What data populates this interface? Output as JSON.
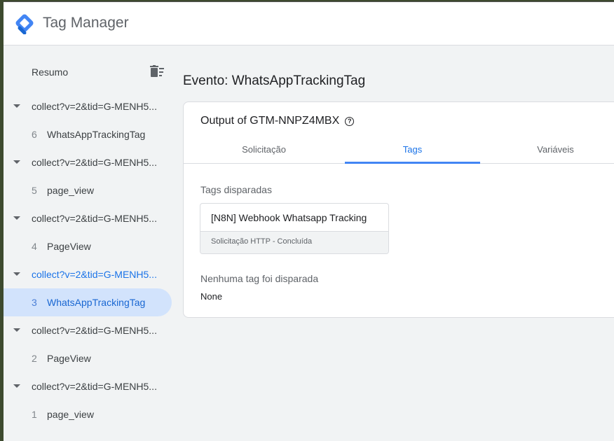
{
  "header": {
    "title": "Tag Manager"
  },
  "sidebar": {
    "summary_label": "Resumo",
    "groups": [
      {
        "label": "collect?v=2&tid=G-MENH5...",
        "child_num": "6",
        "child_name": "WhatsAppTrackingTag"
      },
      {
        "label": "collect?v=2&tid=G-MENH5...",
        "child_num": "5",
        "child_name": "page_view"
      },
      {
        "label": "collect?v=2&tid=G-MENH5...",
        "child_num": "4",
        "child_name": "PageView"
      },
      {
        "label": "collect?v=2&tid=G-MENH5...",
        "child_num": "3",
        "child_name": "WhatsAppTrackingTag",
        "selected": true
      },
      {
        "label": "collect?v=2&tid=G-MENH5...",
        "child_num": "2",
        "child_name": "PageView"
      },
      {
        "label": "collect?v=2&tid=G-MENH5...",
        "child_num": "1",
        "child_name": "page_view"
      }
    ]
  },
  "main": {
    "event_title": "Evento: WhatsAppTrackingTag",
    "card_title": "Output of GTM-NNPZ4MBX",
    "tabs": [
      {
        "label": "Solicitação"
      },
      {
        "label": "Tags",
        "active": true
      },
      {
        "label": "Variáveis"
      }
    ],
    "fired_label": "Tags disparadas",
    "fired_tag": {
      "name": "[N8N] Webhook Whatsapp Tracking",
      "status": "Solicitação HTTP - Concluída"
    },
    "not_fired_label": "Nenhuma tag foi disparada",
    "not_fired_value": "None"
  },
  "colors": {
    "accent": "#1a73e8",
    "selected_bg": "#d2e3fc"
  }
}
